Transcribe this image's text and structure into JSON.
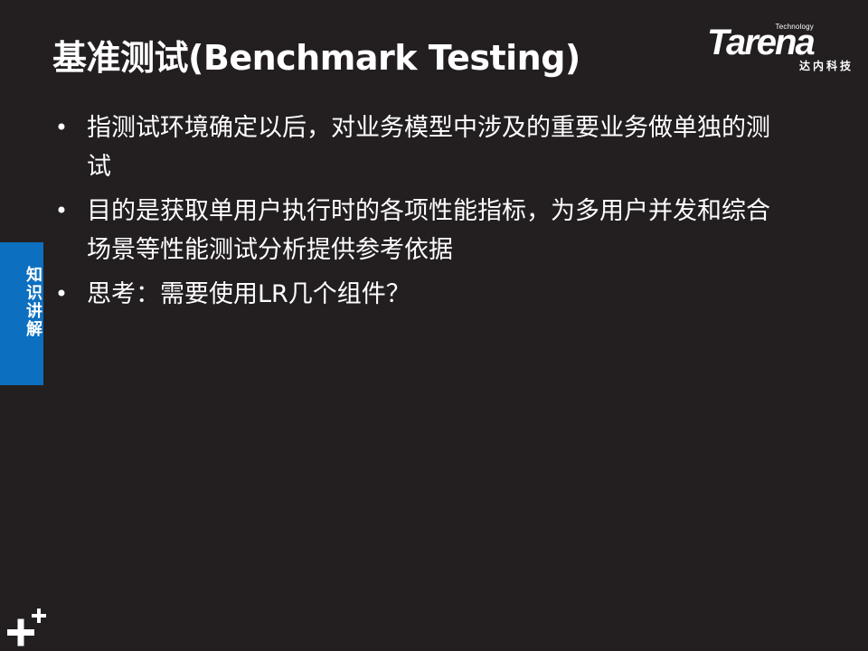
{
  "slide": {
    "title": "基准测试(Benchmark Testing)",
    "logo": {
      "tagline": "Technology",
      "wordmark": "Tarena",
      "chinese_name": "达内科技"
    },
    "bullets": [
      "指测试环境确定以后，对业务模型中涉及的重要业务做单独的测试",
      "目的是获取单用户执行时的各项性能指标，为多用户并发和综合场景等性能测试分析提供参考依据",
      "思考：需要使用LR几个组件？"
    ],
    "bullet_marker": "•",
    "side_tab": {
      "label": "知识讲解"
    },
    "corner_icon": "plus-plus-icon",
    "colors": {
      "background": "#231f20",
      "text": "#ffffff",
      "accent": "#0c6fc0"
    }
  }
}
